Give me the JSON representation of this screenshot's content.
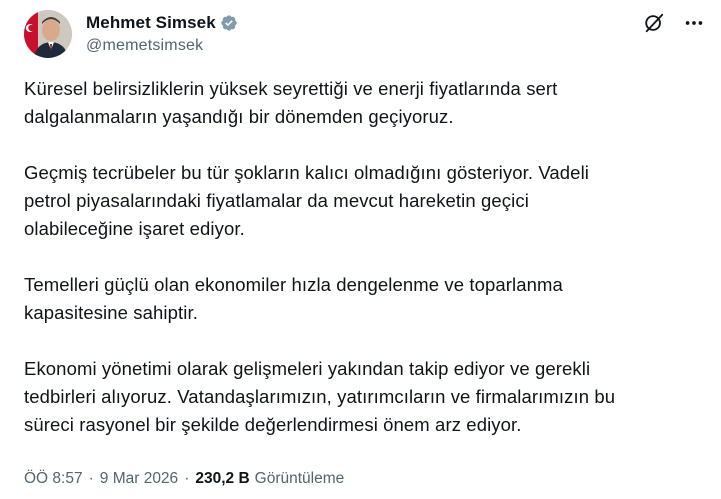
{
  "author": {
    "display_name": "Mehmet Simsek",
    "handle": "@memetsimsek",
    "verified_color": "#829aab"
  },
  "header_actions": {
    "grok_icon": "grok-icon",
    "more_icon": "more-icon"
  },
  "tweet": {
    "paragraphs": [
      "Küresel belirsizliklerin yüksek seyrettiği ve enerji fiyatlarında sert\ndalgalanmaların yaşandığı bir dönemden geçiyoruz.",
      "Geçmiş tecrübeler bu tür şokların kalıcı olmadığını gösteriyor. Vadeli\npetrol piyasalarındaki fiyatlamalar da mevcut hareketin geçici\nolabileceğine işaret ediyor.",
      "Temelleri güçlü olan ekonomiler hızla dengelenme ve toparlanma\nkapasitesine sahiptir.",
      "Ekonomi yönetimi olarak gelişmeleri yakından takip ediyor ve gerekli\ntedbirleri alıyoruz. Vatandaşlarımızın, yatırımcıların ve firmalarımızın bu\nsüreci rasyonel bir şekilde değerlendirmesi önem arz ediyor."
    ]
  },
  "meta": {
    "time": "ÖÖ 8:57",
    "separator": "·",
    "date": "9 Mar 2026",
    "views_count": "230,2 B",
    "views_label": "Görüntüleme"
  },
  "colors": {
    "text_primary": "#0f1419",
    "text_secondary": "#536471"
  }
}
